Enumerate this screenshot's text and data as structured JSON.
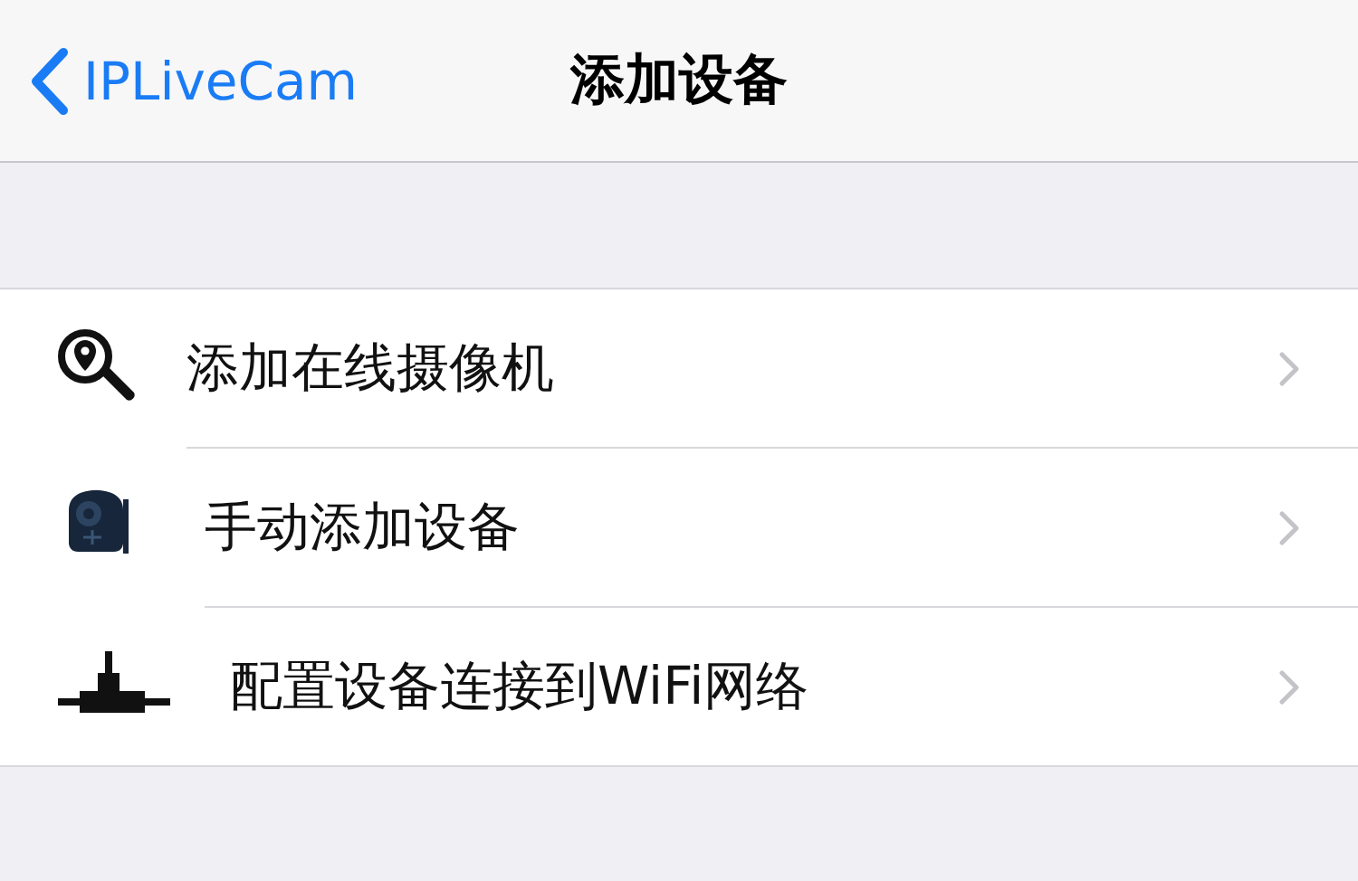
{
  "nav_bar": {
    "back_label": "IPLiveCam",
    "title": "添加设备"
  },
  "menu_items": [
    {
      "label": "添加在线摄像机"
    },
    {
      "label": "手动添加设备"
    },
    {
      "label": "配置设备连接到WiFi网络"
    }
  ]
}
